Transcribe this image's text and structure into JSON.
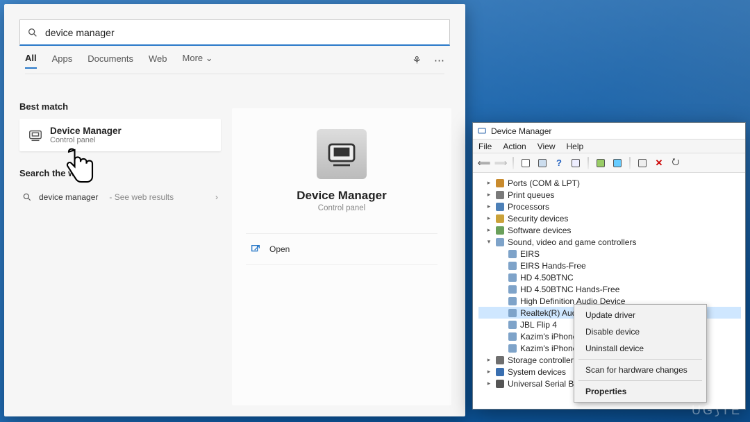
{
  "search": {
    "query": "device manager",
    "tabs": [
      "All",
      "Apps",
      "Documents",
      "Web",
      "More"
    ],
    "best_match_label": "Best match",
    "match_title": "Device Manager",
    "match_sub": "Control panel",
    "search_the_label": "Search the web",
    "web_query": "device manager",
    "web_hint": "See web results",
    "detail_title": "Device Manager",
    "detail_sub": "Control panel",
    "open_label": "Open"
  },
  "dm": {
    "title": "Device Manager",
    "menu": [
      "File",
      "Action",
      "View",
      "Help"
    ],
    "tree": {
      "ports": "Ports (COM & LPT)",
      "printq": "Print queues",
      "proc": "Processors",
      "sec": "Security devices",
      "soft": "Software devices",
      "sound": "Sound, video and game controllers",
      "items": [
        "EIRS",
        "EIRS Hands-Free",
        "HD 4.50BTNC",
        "HD 4.50BTNC Hands-Free",
        "High Definition Audio Device",
        "Realtek(R) Audio",
        "JBL Flip 4",
        "Kazim's iPhone",
        "Kazim's iPhone"
      ],
      "storage": "Storage controllers",
      "system": "System devices",
      "usb": "Universal Serial Bus controllers"
    }
  },
  "ctx": {
    "update": "Update driver",
    "disable": "Disable device",
    "uninstall": "Uninstall device",
    "scan": "Scan for hardware changes",
    "props": "Properties"
  },
  "watermark": "UG⟆TE"
}
